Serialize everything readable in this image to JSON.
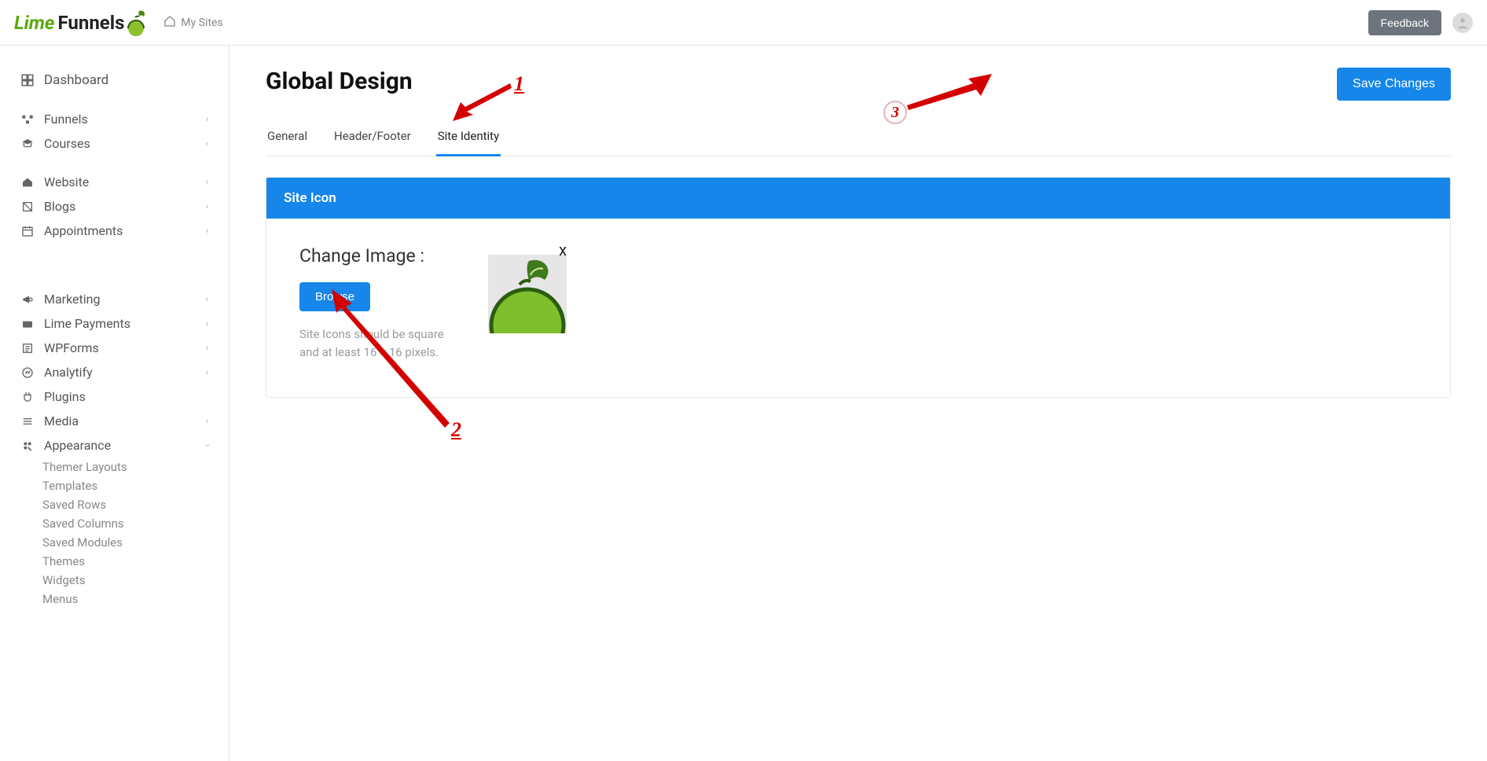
{
  "topbar": {
    "brand_lime": "Lime",
    "brand_funnels": "Funnels",
    "mysites": "My Sites",
    "feedback": "Feedback"
  },
  "sidebar": {
    "dashboard": "Dashboard",
    "group1": [
      {
        "icon": "funnels",
        "label": "Funnels",
        "expandable": true
      },
      {
        "icon": "courses",
        "label": "Courses",
        "expandable": true
      }
    ],
    "group2": [
      {
        "icon": "website",
        "label": "Website",
        "expandable": true
      },
      {
        "icon": "blogs",
        "label": "Blogs",
        "expandable": true
      },
      {
        "icon": "appointments",
        "label": "Appointments",
        "expandable": true
      }
    ],
    "group3": [
      {
        "icon": "marketing",
        "label": "Marketing",
        "expandable": true
      },
      {
        "icon": "payments",
        "label": "Lime Payments",
        "expandable": true
      },
      {
        "icon": "wpforms",
        "label": "WPForms",
        "expandable": true
      },
      {
        "icon": "analytify",
        "label": "Analytify",
        "expandable": true
      },
      {
        "icon": "plugins",
        "label": "Plugins",
        "expandable": false
      },
      {
        "icon": "media",
        "label": "Media",
        "expandable": true
      },
      {
        "icon": "appearance",
        "label": "Appearance",
        "expandable": true,
        "expanded": true
      }
    ],
    "appearance_sub": [
      "Themer Layouts",
      "Templates",
      "Saved Rows",
      "Saved Columns",
      "Saved Modules",
      "Themes",
      "Widgets",
      "Menus"
    ]
  },
  "page": {
    "title": "Global Design",
    "save": "Save Changes",
    "tabs": [
      "General",
      "Header/Footer",
      "Site Identity"
    ],
    "active_tab": 2,
    "panel_title": "Site Icon",
    "change_label": "Change Image :",
    "browse": "Browse",
    "hint": "Site Icons should be square and at least 16 × 16 pixels.",
    "close_x": "x"
  },
  "annotations": {
    "n1": "1",
    "n2": "2",
    "n3": "3"
  }
}
